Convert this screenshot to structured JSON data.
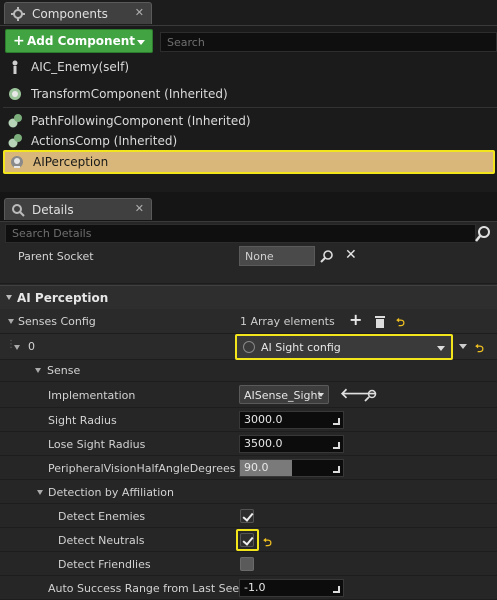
{
  "components_panel": {
    "tab_label": "Components",
    "add_button_label": "Add Component",
    "search_placeholder": "Search",
    "self_item": "AIC_Enemy(self)",
    "items": [
      {
        "label": "TransformComponent (Inherited)",
        "icon": "transform-component-icon"
      },
      {
        "label": "PathFollowingComponent (Inherited)",
        "icon": "component-gear-icon"
      },
      {
        "label": "ActionsComp (Inherited)",
        "icon": "component-gear-icon"
      },
      {
        "label": "AIPerception",
        "icon": "perception-component-icon",
        "selected": true
      }
    ]
  },
  "details_panel": {
    "tab_label": "Details",
    "search_placeholder": "Search Details",
    "parent_socket": {
      "label": "Parent Socket",
      "value": "None"
    },
    "category_title": "AI Perception",
    "senses_config": {
      "label": "Senses Config",
      "value": "1 Array elements"
    },
    "element": {
      "index": "0",
      "value": "AI Sight config"
    },
    "sense_group": "Sense",
    "implementation": {
      "label": "Implementation",
      "value": "AISense_Sight"
    },
    "sight_radius": {
      "label": "Sight Radius",
      "value": "3000.0"
    },
    "lose_sight_radius": {
      "label": "Lose Sight Radius",
      "value": "3500.0"
    },
    "peripheral": {
      "label": "PeripheralVisionHalfAngleDegrees",
      "value": "90.0",
      "slider_fraction": 0.5
    },
    "affiliation_group": "Detection by Affiliation",
    "detect_enemies": {
      "label": "Detect Enemies",
      "checked": true
    },
    "detect_neutrals": {
      "label": "Detect Neutrals",
      "checked": true
    },
    "detect_friendlies": {
      "label": "Detect Friendlies",
      "checked": false
    },
    "auto_success": {
      "label": "Auto Success Range from Last Seen",
      "value": "-1.0"
    }
  },
  "colors": {
    "accent_green": "#41a342",
    "selection_fill": "#d9b77a",
    "selection_border": "#f3e51c",
    "reset_arrow": "#f0c020"
  }
}
